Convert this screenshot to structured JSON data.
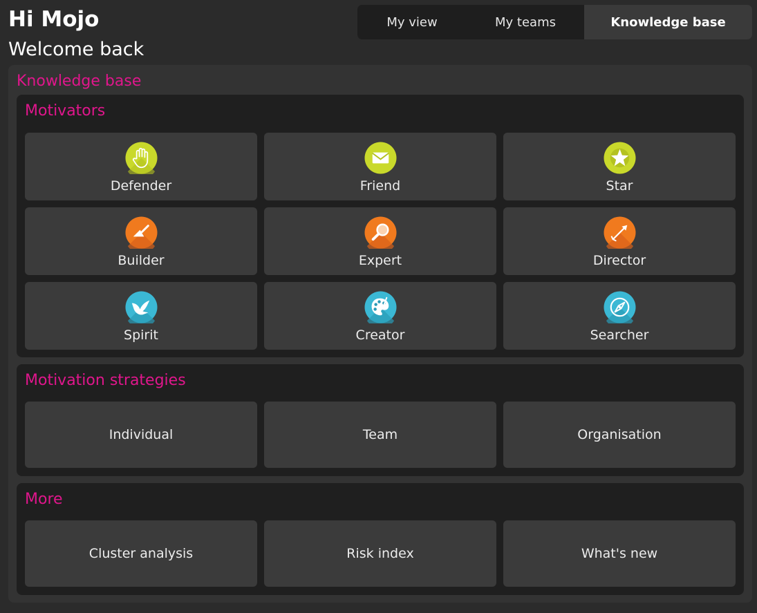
{
  "header": {
    "greeting": "Hi Mojo",
    "subtitle": "Welcome back"
  },
  "tabs": [
    {
      "label": "My view",
      "active": false
    },
    {
      "label": "My teams",
      "active": false
    },
    {
      "label": "Knowledge base",
      "active": true
    }
  ],
  "knowledge_base": {
    "title": "Knowledge base",
    "motivators": {
      "title": "Motivators",
      "items": [
        {
          "label": "Defender",
          "icon": "hand-icon",
          "color": "#c8d82a"
        },
        {
          "label": "Friend",
          "icon": "envelope-icon",
          "color": "#c8d82a"
        },
        {
          "label": "Star",
          "icon": "star-icon",
          "color": "#c8d82a"
        },
        {
          "label": "Builder",
          "icon": "trowel-icon",
          "color": "#f07a1e"
        },
        {
          "label": "Expert",
          "icon": "magnifier-icon",
          "color": "#f07a1e"
        },
        {
          "label": "Director",
          "icon": "arrow-icon",
          "color": "#f07a1e"
        },
        {
          "label": "Spirit",
          "icon": "bird-icon",
          "color": "#3bb8d4"
        },
        {
          "label": "Creator",
          "icon": "palette-icon",
          "color": "#3bb8d4"
        },
        {
          "label": "Searcher",
          "icon": "compass-icon",
          "color": "#3bb8d4"
        }
      ]
    },
    "strategies": {
      "title": "Motivation strategies",
      "items": [
        "Individual",
        "Team",
        "Organisation"
      ]
    },
    "more": {
      "title": "More",
      "items": [
        "Cluster analysis",
        "Risk index",
        "What's new"
      ]
    }
  }
}
